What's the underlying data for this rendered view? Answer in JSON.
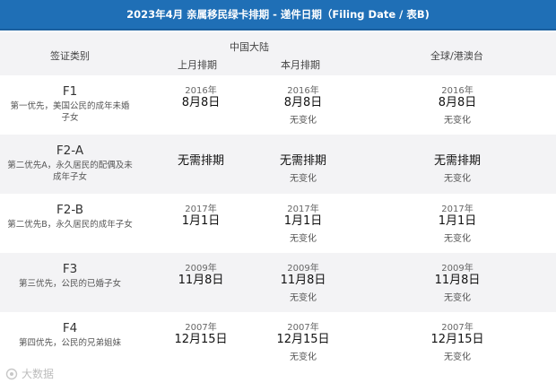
{
  "title": "2023年4月 亲属移民绿卡排期 - 递件日期（Filing Date / 表B)",
  "header": {
    "category": "签证类别",
    "china": "中国大陆",
    "last_month": "上月排期",
    "this_month": "本月排期",
    "global": "全球/港澳台"
  },
  "rows": [
    {
      "code": "F1",
      "desc": "第一优先，美国公民的成年未婚子女",
      "last_year": "2016年",
      "last_date": "8月8日",
      "this_year": "2016年",
      "this_date": "8月8日",
      "this_status": "无变化",
      "global_year": "2016年",
      "global_date": "8月8日",
      "global_status": "无变化"
    },
    {
      "code": "F2-A",
      "desc": "第二优先A，永久居民的配偶及未成年子女",
      "last_year": "",
      "last_date": "无需排期",
      "this_year": "",
      "this_date": "无需排期",
      "this_status": "无变化",
      "global_year": "",
      "global_date": "无需排期",
      "global_status": "无变化"
    },
    {
      "code": "F2-B",
      "desc": "第二优先B，永久居民的成年子女",
      "last_year": "2017年",
      "last_date": "1月1日",
      "this_year": "2017年",
      "this_date": "1月1日",
      "this_status": "无变化",
      "global_year": "2017年",
      "global_date": "1月1日",
      "global_status": "无变化"
    },
    {
      "code": "F3",
      "desc": "第三优先，公民的已婚子女",
      "last_year": "2009年",
      "last_date": "11月8日",
      "this_year": "2009年",
      "this_date": "11月8日",
      "this_status": "无变化",
      "global_year": "2009年",
      "global_date": "11月8日",
      "global_status": "无变化"
    },
    {
      "code": "F4",
      "desc": "第四优先，公民的兄弟姐妹",
      "last_year": "2007年",
      "last_date": "12月15日",
      "this_year": "2007年",
      "this_date": "12月15日",
      "this_status": "无变化",
      "global_year": "2007年",
      "global_date": "12月15日",
      "global_status": "无变化"
    }
  ],
  "watermark": "大数据"
}
